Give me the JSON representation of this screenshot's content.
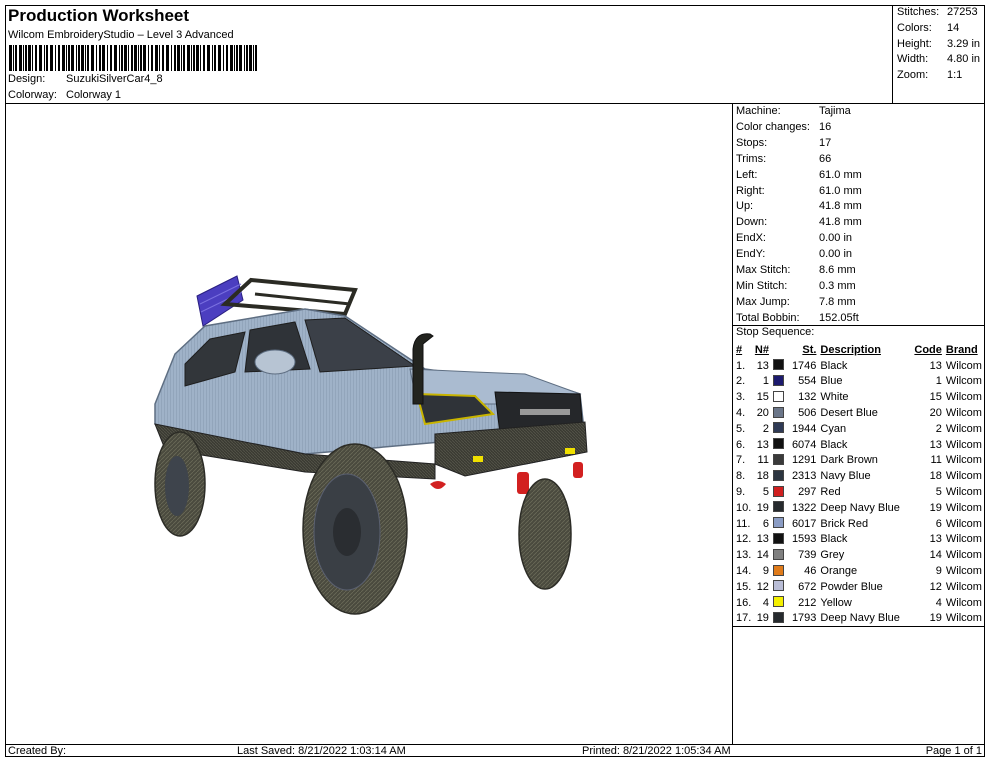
{
  "header": {
    "title": "Production Worksheet",
    "subtitle": "Wilcom EmbroideryStudio – Level 3 Advanced",
    "design_label": "Design:",
    "design_value": "SuzukiSilverCar4_8",
    "colorway_label": "Colorway:",
    "colorway_value": "Colorway 1"
  },
  "summary": [
    {
      "label": "Stitches:",
      "value": "27253"
    },
    {
      "label": "Colors:",
      "value": "14"
    },
    {
      "label": "Height:",
      "value": "3.29 in"
    },
    {
      "label": "Width:",
      "value": "4.80 in"
    },
    {
      "label": "Zoom:",
      "value": "1:1"
    }
  ],
  "specs": [
    {
      "label": "Machine:",
      "value": "Tajima"
    },
    {
      "label": "Color changes:",
      "value": "16"
    },
    {
      "label": "Stops:",
      "value": "17"
    },
    {
      "label": "Trims:",
      "value": "66"
    },
    {
      "label": "Left:",
      "value": "61.0 mm"
    },
    {
      "label": "Right:",
      "value": "61.0 mm"
    },
    {
      "label": "Up:",
      "value": "41.8 mm"
    },
    {
      "label": "Down:",
      "value": "41.8 mm"
    },
    {
      "label": "EndX:",
      "value": "0.00 in"
    },
    {
      "label": "EndY:",
      "value": "0.00 in"
    },
    {
      "label": "Max Stitch:",
      "value": "8.6 mm"
    },
    {
      "label": "Min Stitch:",
      "value": "0.3 mm"
    },
    {
      "label": "Max Jump:",
      "value": "7.8 mm"
    },
    {
      "label": "Total Bobbin:",
      "value": "152.05ft"
    }
  ],
  "stop_sequence": {
    "label": "Stop Sequence:",
    "columns": [
      "#",
      "N#",
      "St.",
      "Description",
      "Code",
      "Brand"
    ],
    "rows": [
      {
        "num": "1.",
        "n": "13",
        "color": "#111111",
        "st": "1746",
        "desc": "Black",
        "code": "13",
        "brand": "Wilcom"
      },
      {
        "num": "2.",
        "n": "1",
        "color": "#1c1a6e",
        "st": "554",
        "desc": "Blue",
        "code": "1",
        "brand": "Wilcom"
      },
      {
        "num": "3.",
        "n": "15",
        "color": "#ffffff",
        "st": "132",
        "desc": "White",
        "code": "15",
        "brand": "Wilcom"
      },
      {
        "num": "4.",
        "n": "20",
        "color": "#6b7689",
        "st": "506",
        "desc": "Desert Blue",
        "code": "20",
        "brand": "Wilcom"
      },
      {
        "num": "5.",
        "n": "2",
        "color": "#2f3a55",
        "st": "1944",
        "desc": "Cyan",
        "code": "2",
        "brand": "Wilcom"
      },
      {
        "num": "6.",
        "n": "13",
        "color": "#111111",
        "st": "6074",
        "desc": "Black",
        "code": "13",
        "brand": "Wilcom"
      },
      {
        "num": "7.",
        "n": "11",
        "color": "#3a3a3a",
        "st": "1291",
        "desc": "Dark Brown",
        "code": "11",
        "brand": "Wilcom"
      },
      {
        "num": "8.",
        "n": "18",
        "color": "#2c3540",
        "st": "2313",
        "desc": "Navy Blue",
        "code": "18",
        "brand": "Wilcom"
      },
      {
        "num": "9.",
        "n": "5",
        "color": "#d01f1f",
        "st": "297",
        "desc": "Red",
        "code": "5",
        "brand": "Wilcom"
      },
      {
        "num": "10.",
        "n": "19",
        "color": "#262a2e",
        "st": "1322",
        "desc": "Deep Navy Blue",
        "code": "19",
        "brand": "Wilcom"
      },
      {
        "num": "11.",
        "n": "6",
        "color": "#8a9cc4",
        "st": "6017",
        "desc": "Brick Red",
        "code": "6",
        "brand": "Wilcom"
      },
      {
        "num": "12.",
        "n": "13",
        "color": "#111111",
        "st": "1593",
        "desc": "Black",
        "code": "13",
        "brand": "Wilcom"
      },
      {
        "num": "13.",
        "n": "14",
        "color": "#808080",
        "st": "739",
        "desc": "Grey",
        "code": "14",
        "brand": "Wilcom"
      },
      {
        "num": "14.",
        "n": "9",
        "color": "#e07b1a",
        "st": "46",
        "desc": "Orange",
        "code": "9",
        "brand": "Wilcom"
      },
      {
        "num": "15.",
        "n": "12",
        "color": "#b9bdd6",
        "st": "672",
        "desc": "Powder Blue",
        "code": "12",
        "brand": "Wilcom"
      },
      {
        "num": "16.",
        "n": "4",
        "color": "#f4f000",
        "st": "212",
        "desc": "Yellow",
        "code": "4",
        "brand": "Wilcom"
      },
      {
        "num": "17.",
        "n": "19",
        "color": "#262a2e",
        "st": "1793",
        "desc": "Deep Navy Blue",
        "code": "19",
        "brand": "Wilcom"
      }
    ]
  },
  "footer": {
    "created_by": "Created By:",
    "last_saved": "Last Saved: 8/21/2022 1:03:14 AM",
    "printed": "Printed: 8/21/2022 1:05:34 AM",
    "page": "Page 1 of 1"
  }
}
